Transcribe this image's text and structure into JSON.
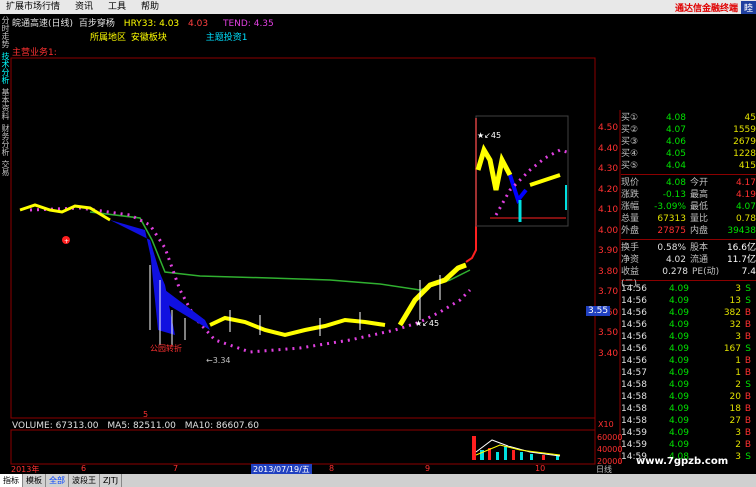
{
  "menu": [
    "扩展市场行情",
    "资讯",
    "工具",
    "帮助"
  ],
  "brand": "通达信金融终端",
  "menu_extra": "睦",
  "left_tabs": [
    "分时走势",
    "技术分析",
    "基本资料",
    "财务分析",
    "交易"
  ],
  "header": {
    "stock": "皖通高速(日线)",
    "indicator": "百步穿杨",
    "hry_label": "HRY33:",
    "hry_value": "4.03",
    "hry_value2": "4.03",
    "tend_label": "TEND:",
    "tend_value": "4.35"
  },
  "sector_line": {
    "a": "所属地区",
    "b": "安徽板块",
    "c": "主题投资1"
  },
  "main_business": "主营业务1:",
  "price_axis": [
    "4.50",
    "4.40",
    "4.30",
    "4.20",
    "4.10",
    "4.00",
    "3.90",
    "3.80",
    "3.70",
    "3.60",
    "3.50",
    "3.40"
  ],
  "price_marker": "3.55",
  "annotations": {
    "low": "←3.34",
    "low_label": "公园转折",
    "mark1": "★↙45",
    "mark2": "★↙45",
    "five": "5"
  },
  "volume_header": {
    "vol": "VOLUME: 67313.00",
    "ma5": "MA5: 82511.00",
    "ma10": "MA10: 86607.60"
  },
  "volume_axis": [
    "60000",
    "40000",
    "20000"
  ],
  "volume_unit": "X10",
  "date_axis": [
    "2013年",
    "6",
    "7",
    "2013/07/19/五",
    "8",
    "9",
    "10"
  ],
  "quote": {
    "asks": [
      {
        "l": "买①",
        "p": "4.08",
        "v": "45"
      },
      {
        "l": "买②",
        "p": "4.07",
        "v": "1559"
      },
      {
        "l": "买③",
        "p": "4.06",
        "v": "2679"
      },
      {
        "l": "买④",
        "p": "4.05",
        "v": "1228"
      },
      {
        "l": "买⑤",
        "p": "4.04",
        "v": "415"
      }
    ],
    "stats": [
      {
        "l": "现价",
        "v1": "4.08",
        "l2": "今开",
        "v2": "4.17"
      },
      {
        "l": "涨跌",
        "v1": "-0.13",
        "l2": "最高",
        "v2": "4.19"
      },
      {
        "l": "涨幅",
        "v1": "-3.09%",
        "l2": "最低",
        "v2": "4.07"
      },
      {
        "l": "总量",
        "v1": "67313",
        "l2": "量比",
        "v2": "0.78"
      },
      {
        "l": "外盘",
        "v1": "27875",
        "l2": "内盘",
        "v2": "39438"
      },
      {
        "l": "换手",
        "v1": "0.58%",
        "l2": "股本",
        "v2": "16.6亿"
      },
      {
        "l": "净资",
        "v1": "4.02",
        "l2": "流通",
        "v2": "11.7亿"
      },
      {
        "l": "收益(二)",
        "v1": "0.278",
        "l2": "PE(动)",
        "v2": "7.4"
      }
    ],
    "ticks": [
      {
        "t": "14:56",
        "p": "4.09",
        "v": "3",
        "s": "S"
      },
      {
        "t": "14:56",
        "p": "4.09",
        "v": "13",
        "s": "S"
      },
      {
        "t": "14:56",
        "p": "4.09",
        "v": "382",
        "s": "B"
      },
      {
        "t": "14:56",
        "p": "4.09",
        "v": "32",
        "s": "B"
      },
      {
        "t": "14:56",
        "p": "4.09",
        "v": "3",
        "s": "B"
      },
      {
        "t": "14:56",
        "p": "4.09",
        "v": "167",
        "s": "S"
      },
      {
        "t": "14:56",
        "p": "4.09",
        "v": "1",
        "s": "B"
      },
      {
        "t": "14:57",
        "p": "4.09",
        "v": "1",
        "s": "B"
      },
      {
        "t": "14:58",
        "p": "4.09",
        "v": "2",
        "s": "S"
      },
      {
        "t": "14:58",
        "p": "4.09",
        "v": "20",
        "s": "B"
      },
      {
        "t": "14:58",
        "p": "4.09",
        "v": "18",
        "s": "B"
      },
      {
        "t": "14:58",
        "p": "4.09",
        "v": "27",
        "s": "B"
      },
      {
        "t": "14:59",
        "p": "4.09",
        "v": "3",
        "s": "B"
      },
      {
        "t": "14:59",
        "p": "4.09",
        "v": "2",
        "s": "B"
      },
      {
        "t": "14:59",
        "p": "4.08",
        "v": "3",
        "s": "S"
      }
    ]
  },
  "bottom_tabs": [
    "指标",
    "模板",
    "全部",
    "波段王",
    "ZJTJ"
  ],
  "right_tab": "日线",
  "watermark": "www.7gpzb.com",
  "colors": {
    "up": "#ff3030",
    "down": "#00e0e0",
    "yellow": "#ffff00",
    "magenta": "#e040e0",
    "blue": "#0000ff",
    "green": "#30b030",
    "white": "#ffffff"
  }
}
